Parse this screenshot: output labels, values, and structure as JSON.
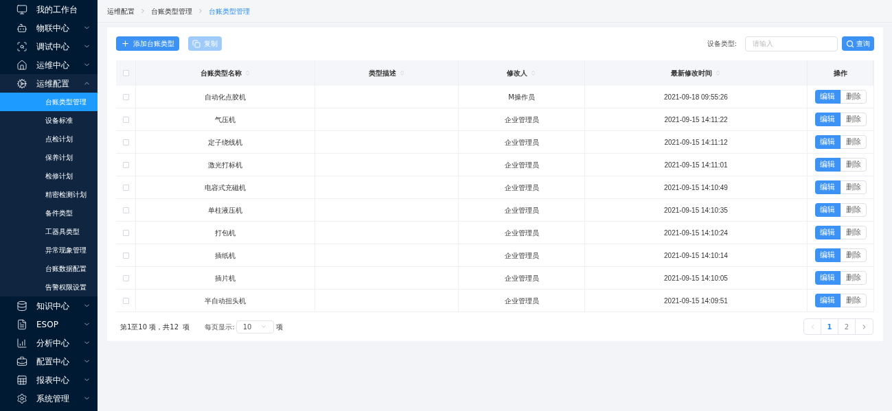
{
  "sidebar": {
    "items": [
      {
        "label": "我的工作台"
      },
      {
        "label": "物联中心",
        "expanded": false
      },
      {
        "label": "调试中心",
        "expanded": false
      },
      {
        "label": "运维中心",
        "expanded": false
      },
      {
        "label": "运维配置",
        "expanded": true,
        "children": [
          {
            "label": "台账类型管理",
            "selected": true
          },
          {
            "label": "设备标准",
            "selected": false
          },
          {
            "label": "点检计划",
            "selected": false
          },
          {
            "label": "保养计划",
            "selected": false
          },
          {
            "label": "检修计划",
            "selected": false
          },
          {
            "label": "精密检测计划",
            "selected": false
          },
          {
            "label": "备件类型",
            "selected": false
          },
          {
            "label": "工器具类型",
            "selected": false
          },
          {
            "label": "异常现象管理",
            "selected": false
          },
          {
            "label": "台账数据配置",
            "selected": false
          },
          {
            "label": "告警权限设置",
            "selected": false
          }
        ]
      },
      {
        "label": "知识中心",
        "expanded": false
      },
      {
        "label": "ESOP",
        "expanded": false
      },
      {
        "label": "分析中心",
        "expanded": false
      },
      {
        "label": "配置中心",
        "expanded": false
      },
      {
        "label": "报表中心",
        "expanded": false
      },
      {
        "label": "系统管理",
        "expanded": false
      }
    ]
  },
  "breadcrumb": [
    {
      "label": "运维配置",
      "current": false
    },
    {
      "label": "台账类型管理",
      "current": false
    },
    {
      "label": "台账类型管理",
      "current": true
    }
  ],
  "toolbar": {
    "add_button": "添加台账类型",
    "copy_button": {
      "label": "复制",
      "disabled": true
    },
    "filter_label": "设备类型:",
    "filter_placeholder": "请输入",
    "search_button": "查询"
  },
  "table": {
    "select_all_checked": false,
    "columns": [
      {
        "label": "台账类型名称",
        "sortable": true
      },
      {
        "label": "类型描述",
        "sortable": true
      },
      {
        "label": "修改人",
        "sortable": true
      },
      {
        "label": "最新修改时间",
        "sortable": true
      },
      {
        "label": "操作",
        "sortable": false
      }
    ],
    "rows": [
      {
        "checked": false,
        "name": "自动化点胶机",
        "modifier": "M操作员",
        "time": "2021-09-18 09:55:26",
        "edit": "编辑",
        "delete": "删除"
      },
      {
        "checked": false,
        "name": "气压机",
        "modifier": "企业管理员",
        "time": "2021-09-15 14:11:22",
        "edit": "编辑",
        "delete": "删除"
      },
      {
        "checked": false,
        "name": "定子绕线机",
        "modifier": "企业管理员",
        "time": "2021-09-15 14:11:12",
        "edit": "编辑",
        "delete": "删除"
      },
      {
        "checked": false,
        "name": "激光打标机",
        "modifier": "企业管理员",
        "time": "2021-09-15 14:11:01",
        "edit": "编辑",
        "delete": "删除"
      },
      {
        "checked": false,
        "name": "电容式充磁机",
        "modifier": "企业管理员",
        "time": "2021-09-15 14:10:49",
        "edit": "编辑",
        "delete": "删除"
      },
      {
        "checked": false,
        "name": "单柱液压机",
        "modifier": "企业管理员",
        "time": "2021-09-15 14:10:35",
        "edit": "编辑",
        "delete": "删除"
      },
      {
        "checked": false,
        "name": "打包机",
        "modifier": "企业管理员",
        "time": "2021-09-15 14:10:24",
        "edit": "编辑",
        "delete": "删除"
      },
      {
        "checked": false,
        "name": "插纸机",
        "modifier": "企业管理员",
        "time": "2021-09-15 14:10:14",
        "edit": "编辑",
        "delete": "删除"
      },
      {
        "checked": false,
        "name": "插片机",
        "modifier": "企业管理员",
        "time": "2021-09-15 14:10:05",
        "edit": "编辑",
        "delete": "删除"
      },
      {
        "checked": false,
        "name": "半自动扭头机",
        "modifier": "企业管理员",
        "time": "2021-09-15 14:09:51",
        "edit": "编辑",
        "delete": "删除"
      }
    ]
  },
  "footer": {
    "summary": "第1至10 项，共12  项",
    "page_size_label": "每页显示:",
    "page_size": "10",
    "page_size_suffix": "项",
    "prev_disabled": true,
    "next_disabled": false,
    "pages": [
      {
        "label": "1",
        "selected": true
      },
      {
        "label": "2",
        "selected": false
      }
    ]
  }
}
